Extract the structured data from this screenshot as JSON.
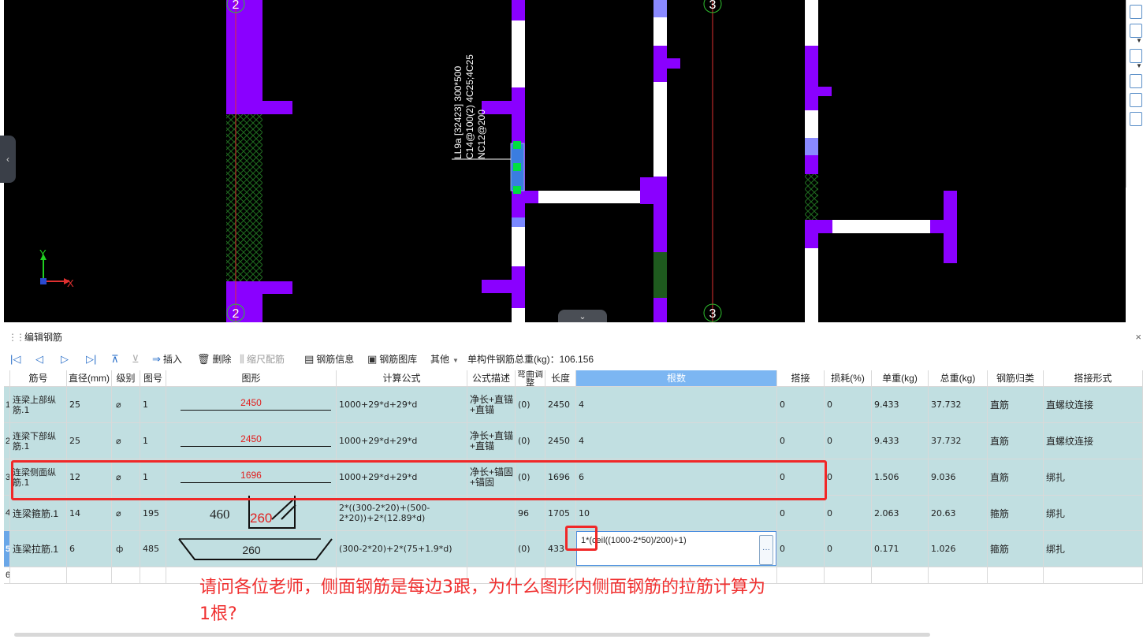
{
  "cad": {
    "axis_labels": [
      "2",
      "2",
      "3",
      "3"
    ],
    "beam_annotation": [
      "LL9a [32423] 300*500",
      "C14@100(2) 4C25;4C25",
      "NC12@200"
    ],
    "coord_x": "X",
    "coord_y": "Y",
    "colors": {
      "background": "#000000",
      "wall": "#8a00ff",
      "beam": "#ffffff",
      "grip": "#00e040",
      "selected": "#3a7de0"
    }
  },
  "panel": {
    "title": "编辑钢筋",
    "close": "×",
    "toolbar": {
      "insert": "插入",
      "delete": "删除",
      "scale": "缩尺配筋",
      "info": "钢筋信息",
      "library": "钢筋图库",
      "other": "其他",
      "total_weight": "单构件钢筋总重(kg)：106.156"
    }
  },
  "table": {
    "headers": [
      "",
      "筋号",
      "直径(mm)",
      "级别",
      "图号",
      "图形",
      "计算公式",
      "公式描述",
      "弯曲调整",
      "长度",
      "根数",
      "搭接",
      "损耗(%)",
      "单重(kg)",
      "总重(kg)",
      "钢筋归类",
      "搭接形式"
    ],
    "rows": [
      {
        "no": "1",
        "name": "连梁上部纵筋.1",
        "dia": "25",
        "grade": "⌀",
        "fig": "1",
        "shape": "2450",
        "formula": "1000+29*d+29*d",
        "desc": "净长+直锚+直锚",
        "bend": "(0)",
        "len": "2450",
        "count": "4",
        "lap": "0",
        "loss": "0",
        "unit_w": "9.433",
        "total_w": "37.732",
        "cat": "直筋",
        "lap_type": "直螺纹连接"
      },
      {
        "no": "2",
        "name": "连梁下部纵筋.1",
        "dia": "25",
        "grade": "⌀",
        "fig": "1",
        "shape": "2450",
        "formula": "1000+29*d+29*d",
        "desc": "净长+直锚+直锚",
        "bend": "(0)",
        "len": "2450",
        "count": "4",
        "lap": "0",
        "loss": "0",
        "unit_w": "9.433",
        "total_w": "37.732",
        "cat": "直筋",
        "lap_type": "直螺纹连接"
      },
      {
        "no": "3",
        "name": "连梁侧面纵筋.1",
        "dia": "12",
        "grade": "⌀",
        "fig": "1",
        "shape": "1696",
        "formula": "1000+29*d+29*d",
        "desc": "净长+锚固+锚固",
        "bend": "(0)",
        "len": "1696",
        "count": "6",
        "lap": "0",
        "loss": "0",
        "unit_w": "1.506",
        "total_w": "9.036",
        "cat": "直筋",
        "lap_type": "绑扎"
      },
      {
        "no": "4",
        "name": "连梁箍筋.1",
        "dia": "14",
        "grade": "⌀",
        "fig": "195",
        "shape_a": "460",
        "shape_b": "260",
        "formula": "2*((300-2*20)+(500-2*20))+2*(12.89*d)",
        "desc": "",
        "bend": "96",
        "len": "1705",
        "count": "10",
        "lap": "0",
        "loss": "0",
        "unit_w": "2.063",
        "total_w": "20.63",
        "cat": "箍筋",
        "lap_type": "绑扎"
      },
      {
        "no": "5",
        "name": "连梁拉筋.1",
        "dia": "6",
        "grade": "ф",
        "fig": "485",
        "shape": "260",
        "formula": "(300-2*20)+2*(75+1.9*d)",
        "desc": "",
        "bend": "(0)",
        "len": "433",
        "count": "1*(ceil((1000-2*50)/200)+1)",
        "lap": "0",
        "loss": "0",
        "unit_w": "0.171",
        "total_w": "1.026",
        "cat": "箍筋",
        "lap_type": "绑扎"
      },
      {
        "no": "6"
      }
    ]
  },
  "annotation": {
    "question_line1": "请问各位老师，侧面钢筋是每边3跟，为什么图形内侧面钢筋的拉筋计算为",
    "question_line2": "1根?"
  }
}
